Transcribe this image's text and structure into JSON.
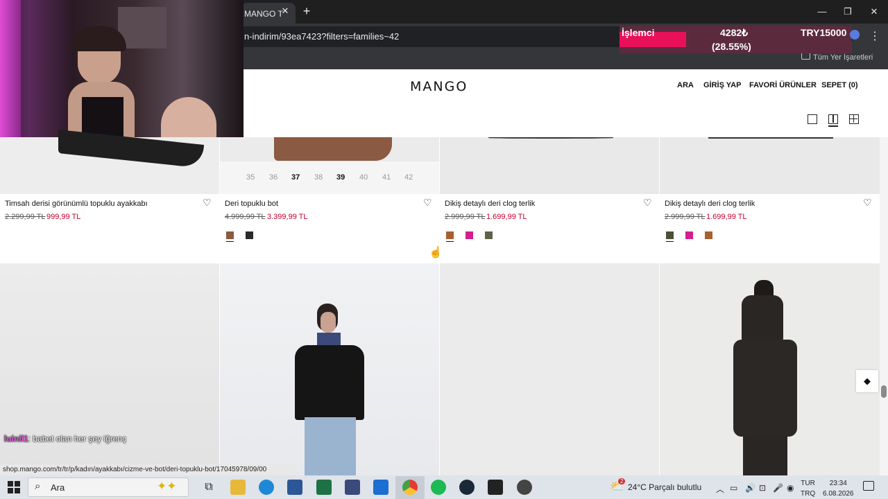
{
  "browser": {
    "tab_title": "MANGO T",
    "url": "n-indirim/93ea7423?filters=families~42",
    "bookmarks_folder": "Tüm Yer İşaretleri",
    "status_url": "shop.mango.com/tr/tr/p/kadın/ayakkabı/cizme-ve-bot/deri-topuklu-bot/17045978/09/00"
  },
  "overlay": {
    "label": "İşlemci",
    "value": "4282₺",
    "percent": "(28.55%)",
    "target": "TRY15000",
    "progress": 0.2855
  },
  "site": {
    "logo": "MANGO",
    "nav": [
      "ARA",
      "GİRİŞ YAP",
      "FAVORİ ÜRÜNLER",
      "SEPET (0)"
    ]
  },
  "products": [
    {
      "name": "Timsah derisi görünümlü topuklu ayakkabı",
      "old_price": "2.299,99 TL",
      "new_price": "999,99 TL",
      "swatches": []
    },
    {
      "name": "Deri topuklu bot",
      "old_price": "4.999,99 TL",
      "new_price": "3.399,99 TL",
      "swatches": [
        "#8a5a40",
        "#2a2a2a"
      ],
      "sizes": [
        "35",
        "36",
        "37",
        "38",
        "39",
        "40",
        "41",
        "42"
      ],
      "available_sizes": [
        "37",
        "39"
      ]
    },
    {
      "name": "Dikiş detaylı deri clog terlik",
      "old_price": "2.999,99 TL",
      "new_price": "1.699,99 TL",
      "swatches": [
        "#a8602e",
        "#d21f8c",
        "#5c6148"
      ]
    },
    {
      "name": "Dikiş detaylı deri clog terlik",
      "old_price": "2.999,99 TL",
      "new_price": "1.699,99 TL",
      "swatches": [
        "#4a5135",
        "#d21f8c",
        "#a8602e"
      ]
    }
  ],
  "chat": {
    "user": "luinil1",
    "message": ": babet olan her şey iğrenç"
  },
  "taskbar": {
    "search": "Ara",
    "weather": "24°C  Parçalı bulutlu",
    "weather_badge": "2",
    "lang_line1": "TUR",
    "lang_line2": "TRQ",
    "time": "23:34",
    "date": "6.08.2026"
  },
  "colors": {
    "sale": "#c7002d",
    "overlay_bar": "#e9105a"
  }
}
